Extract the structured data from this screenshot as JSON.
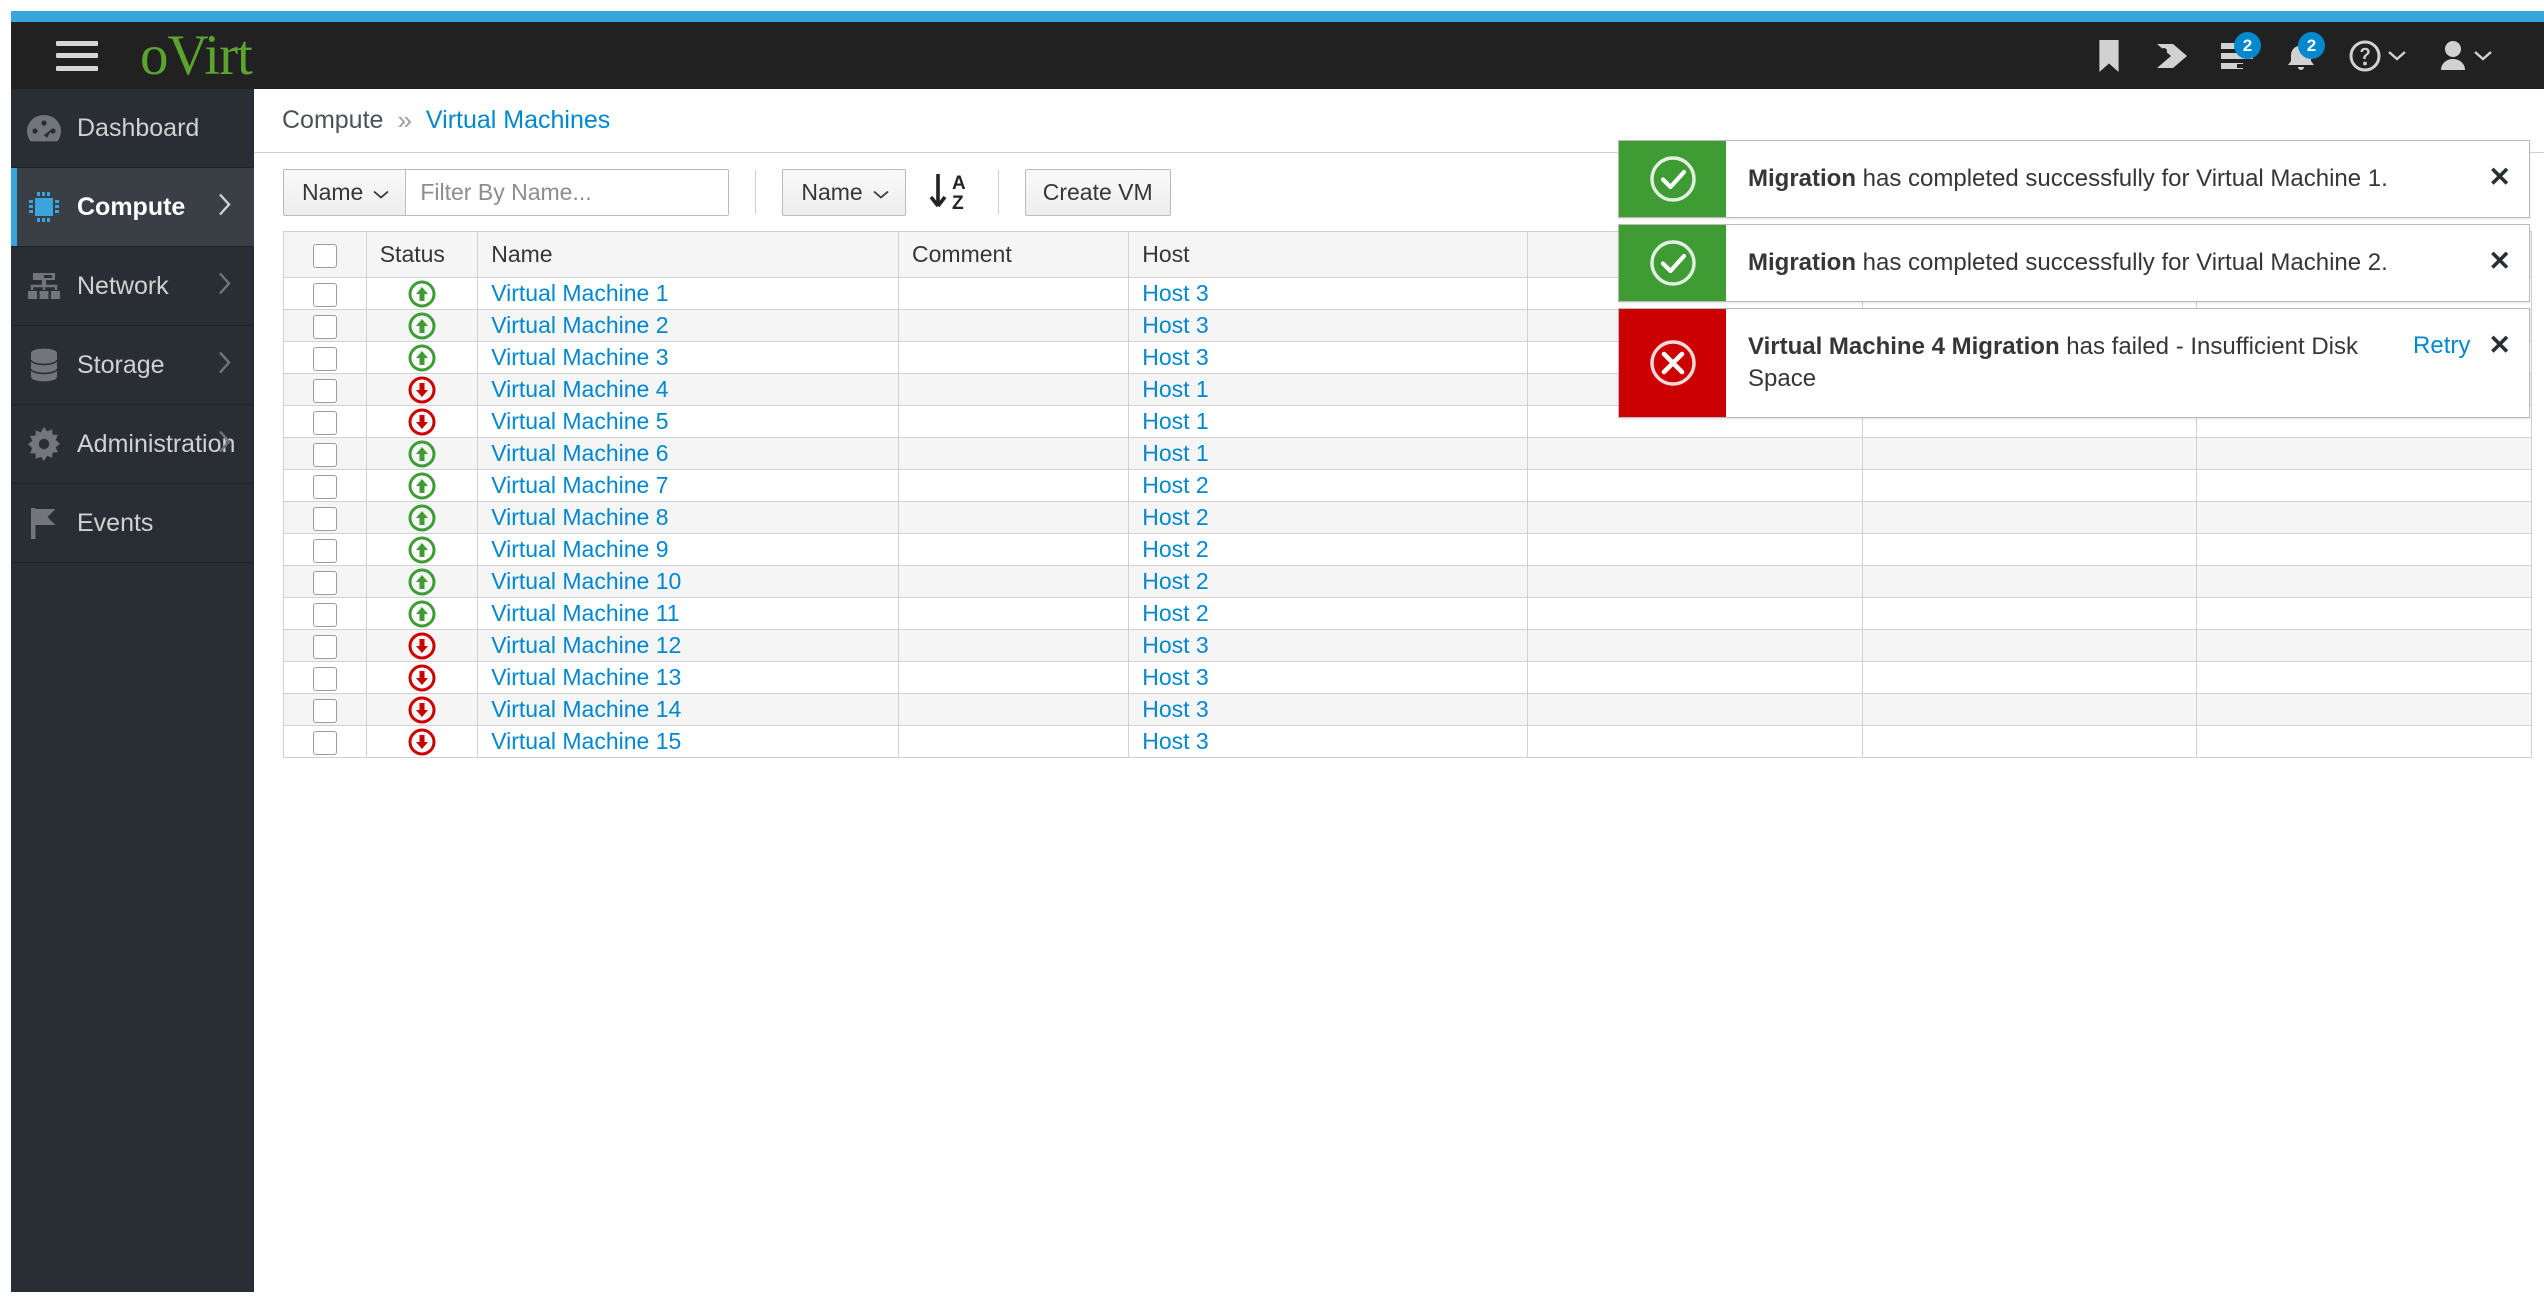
{
  "masthead": {
    "brand": "oVirt",
    "menu_icon": "hamburger-icon",
    "icons": [
      {
        "name": "bookmark-icon",
        "badge": null
      },
      {
        "name": "tag-icon",
        "badge": null
      },
      {
        "name": "tasks-icon",
        "badge": "2"
      },
      {
        "name": "notification-bell-icon",
        "badge": "2"
      },
      {
        "name": "help-icon",
        "badge": null
      },
      {
        "name": "user-icon",
        "badge": null
      }
    ]
  },
  "sidebar": {
    "items": [
      {
        "label": "Dashboard",
        "icon": "dashboard-icon",
        "active": false,
        "chevron": false
      },
      {
        "label": "Compute",
        "icon": "compute-chip-icon",
        "active": true,
        "chevron": true
      },
      {
        "label": "Network",
        "icon": "network-icon",
        "active": false,
        "chevron": true
      },
      {
        "label": "Storage",
        "icon": "storage-icon",
        "active": false,
        "chevron": true
      },
      {
        "label": "Administration",
        "icon": "gear-icon",
        "active": false,
        "chevron": true
      },
      {
        "label": "Events",
        "icon": "flag-icon",
        "active": false,
        "chevron": false
      }
    ]
  },
  "breadcrumb": {
    "root": "Compute",
    "separator": "»",
    "current": "Virtual Machines"
  },
  "toolbar": {
    "filter_field": "Name",
    "filter_placeholder": "Filter By Name...",
    "filter_value": "",
    "sort_field": "Name",
    "sort_direction_icon": "sort-alpha-asc-icon",
    "sort_direction_label": "A\nZ",
    "create_vm_label": "Create VM"
  },
  "table": {
    "columns": [
      "",
      "Status",
      "Name",
      "Comment",
      "Host",
      "",
      "",
      ""
    ],
    "rows": [
      {
        "status": "up",
        "name": "Virtual Machine 1",
        "comment": "",
        "host": "Host 3"
      },
      {
        "status": "up",
        "name": "Virtual Machine 2",
        "comment": "",
        "host": "Host 3"
      },
      {
        "status": "up",
        "name": "Virtual Machine 3",
        "comment": "",
        "host": "Host 3"
      },
      {
        "status": "down",
        "name": "Virtual Machine 4",
        "comment": "",
        "host": "Host 1"
      },
      {
        "status": "down",
        "name": "Virtual Machine 5",
        "comment": "",
        "host": "Host 1"
      },
      {
        "status": "up",
        "name": "Virtual Machine 6",
        "comment": "",
        "host": "Host 1"
      },
      {
        "status": "up",
        "name": "Virtual Machine 7",
        "comment": "",
        "host": "Host 2"
      },
      {
        "status": "up",
        "name": "Virtual Machine 8",
        "comment": "",
        "host": "Host 2"
      },
      {
        "status": "up",
        "name": "Virtual Machine 9",
        "comment": "",
        "host": "Host 2"
      },
      {
        "status": "up",
        "name": "Virtual Machine 10",
        "comment": "",
        "host": "Host 2"
      },
      {
        "status": "up",
        "name": "Virtual Machine 11",
        "comment": "",
        "host": "Host 2"
      },
      {
        "status": "down",
        "name": "Virtual Machine 12",
        "comment": "",
        "host": "Host 3"
      },
      {
        "status": "down",
        "name": "Virtual Machine 13",
        "comment": "",
        "host": "Host 3"
      },
      {
        "status": "down",
        "name": "Virtual Machine 14",
        "comment": "",
        "host": "Host 3"
      },
      {
        "status": "down",
        "name": "Virtual Machine 15",
        "comment": "",
        "host": "Host 3"
      }
    ]
  },
  "toasts": [
    {
      "type": "success",
      "icon": "check-circle-icon",
      "bold": "Migration",
      "rest": " has completed successfully for Virtual Machine 1.",
      "action": null,
      "close": "✕"
    },
    {
      "type": "success",
      "icon": "check-circle-icon",
      "bold": "Migration",
      "rest": " has completed successfully for Virtual Machine 2.",
      "action": null,
      "close": "✕"
    },
    {
      "type": "error",
      "icon": "error-circle-icon",
      "bold": "Virtual Machine 4 Migration",
      "rest": " has failed - Insufficient Disk Space",
      "action": "Retry",
      "close": "✕"
    }
  ],
  "colors": {
    "accent_blue": "#39a5dc",
    "link_blue": "#0088ce",
    "brand_green": "#5ba42f",
    "status_up_green": "#3f9c35",
    "status_down_red": "#cc0000",
    "masthead_dark": "#212121",
    "sidebar_dark": "#292e34"
  }
}
